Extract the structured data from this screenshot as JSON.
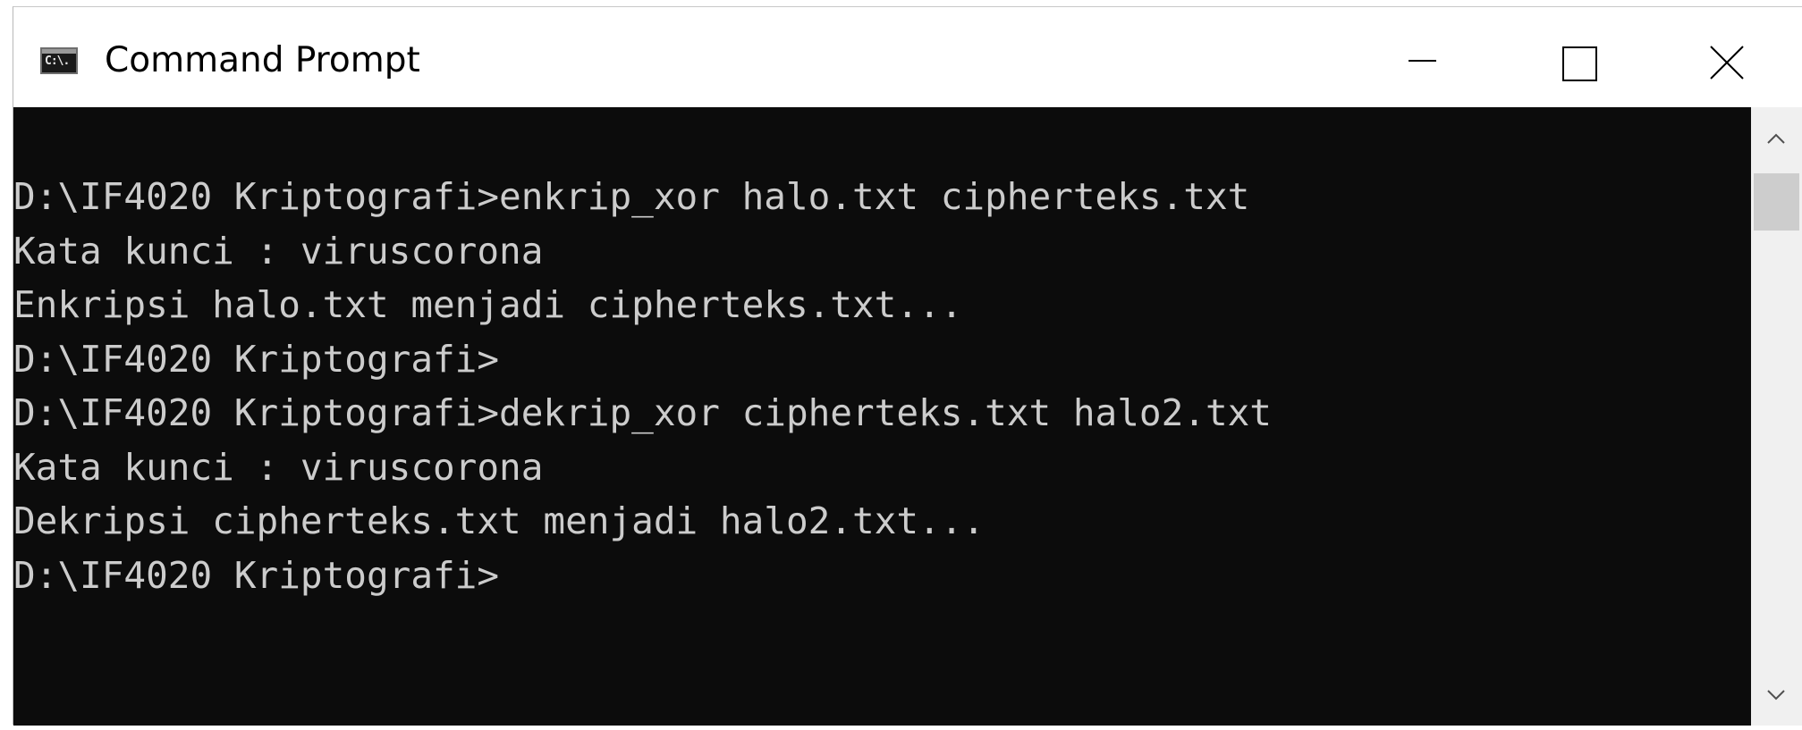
{
  "window": {
    "title": "Command Prompt",
    "icon": "cmd-icon",
    "icon_glyph": "C:\\."
  },
  "controls": {
    "minimize": "minimize-icon",
    "maximize": "maximize-icon",
    "close": "close-icon"
  },
  "console": {
    "background": "#0c0c0c",
    "foreground": "#cccccc",
    "lines": [
      "D:\\IF4020 Kriptografi>enkrip_xor halo.txt cipherteks.txt",
      "Kata kunci : viruscorona",
      "Enkripsi halo.txt menjadi cipherteks.txt...",
      "D:\\IF4020 Kriptografi>",
      "D:\\IF4020 Kriptografi>dekrip_xor cipherteks.txt halo2.txt",
      "Kata kunci : viruscorona",
      "Dekripsi cipherteks.txt menjadi halo2.txt...",
      "D:\\IF4020 Kriptografi>"
    ]
  },
  "scrollbar": {
    "up": "chevron-up-icon",
    "down": "chevron-down-icon"
  }
}
